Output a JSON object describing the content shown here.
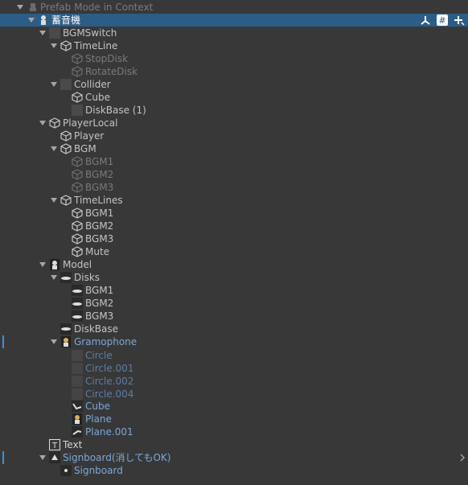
{
  "header": {
    "title": "Prefab Mode in Context"
  },
  "root": {
    "label": "蓄音機"
  },
  "rows": [
    {
      "label": "BGMSwitch"
    },
    {
      "label": "TimeLine"
    },
    {
      "label": "StopDisk"
    },
    {
      "label": "RotateDisk"
    },
    {
      "label": "Collider"
    },
    {
      "label": "Cube"
    },
    {
      "label": "DiskBase (1)"
    },
    {
      "label": "PlayerLocal"
    },
    {
      "label": "Player"
    },
    {
      "label": "BGM"
    },
    {
      "label": "BGM1"
    },
    {
      "label": "BGM2"
    },
    {
      "label": "BGM3"
    },
    {
      "label": "TimeLines"
    },
    {
      "label": "BGM1"
    },
    {
      "label": "BGM2"
    },
    {
      "label": "BGM3"
    },
    {
      "label": "Mute"
    },
    {
      "label": "Model"
    },
    {
      "label": "Disks"
    },
    {
      "label": "BGM1"
    },
    {
      "label": "BGM2"
    },
    {
      "label": "BGM3"
    },
    {
      "label": "DiskBase"
    },
    {
      "label": "Gramophone"
    },
    {
      "label": "Circle"
    },
    {
      "label": "Circle.001"
    },
    {
      "label": "Circle.002"
    },
    {
      "label": "Circle.004"
    },
    {
      "label": "Cube"
    },
    {
      "label": "Plane"
    },
    {
      "label": "Plane.001"
    },
    {
      "label": "Text"
    },
    {
      "label": "Signboard(消してもOK)"
    },
    {
      "label": "Signboard"
    }
  ],
  "colors": {
    "selection": "#2c5d87",
    "prefab_blue": "#7ba7d8",
    "background": "#383838"
  }
}
